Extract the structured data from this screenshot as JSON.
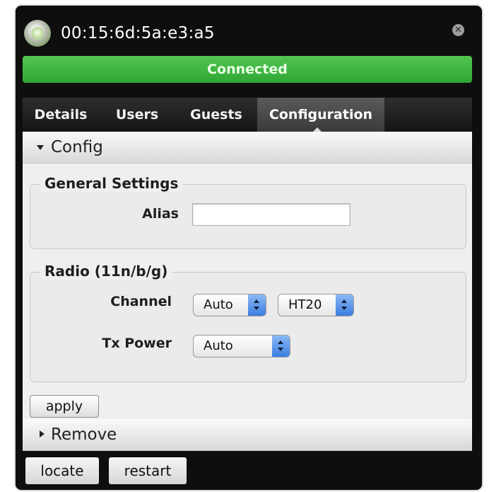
{
  "window": {
    "title": "00:15:6d:5a:e3:a5",
    "status": "Connected",
    "status_color": "#3fb843",
    "status_icon": "status-light-icon",
    "close_icon": "close-icon"
  },
  "tabs": [
    {
      "label": "Details",
      "active": false
    },
    {
      "label": "Users",
      "active": false
    },
    {
      "label": "Guests",
      "active": false
    },
    {
      "label": "Configuration",
      "active": true
    }
  ],
  "config_section": {
    "title": "Config",
    "expanded": true,
    "general": {
      "legend": "General Settings",
      "alias_label": "Alias",
      "alias_value": "",
      "alias_placeholder": ""
    },
    "radio": {
      "legend": "Radio (11n/b/g)",
      "channel_label": "Channel",
      "channel_value": "Auto",
      "ht_value": "HT20",
      "tx_power_label": "Tx Power",
      "tx_power_value": "Auto"
    },
    "apply_label": "apply"
  },
  "remove_section": {
    "title": "Remove",
    "expanded": false
  },
  "footer": {
    "locate_label": "locate",
    "restart_label": "restart"
  }
}
